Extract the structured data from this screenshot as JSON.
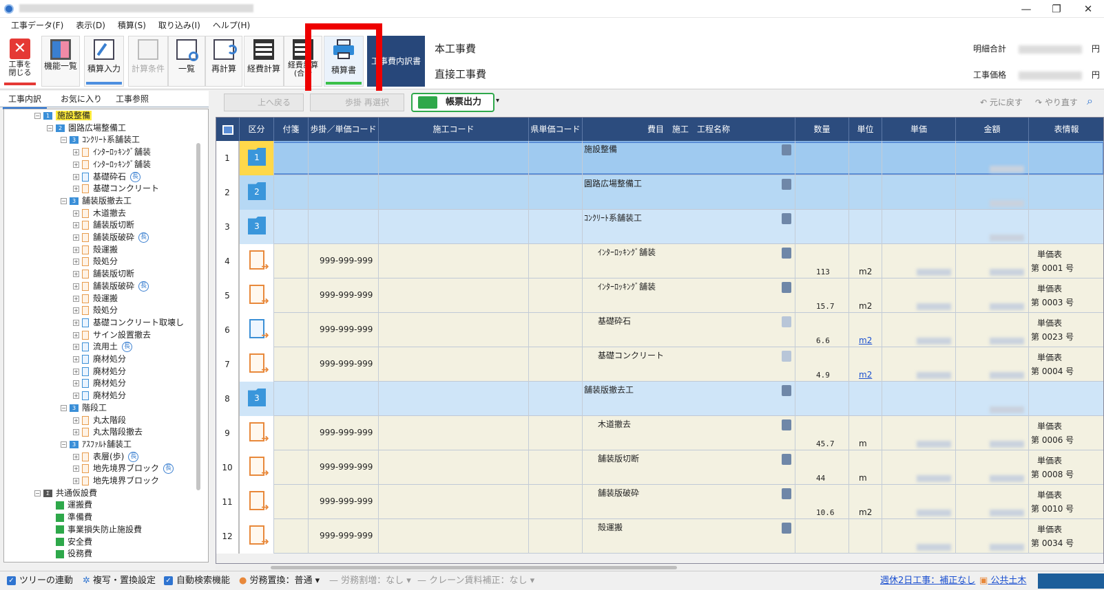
{
  "window": {
    "minimize": "—",
    "maximize": "❐",
    "close": "✕"
  },
  "menu": [
    "工事データ(F)",
    "表示(D)",
    "積算(S)",
    "取り込み(I)",
    "ヘルプ(H)"
  ],
  "ribbon": {
    "close": "工事を\n閉じる",
    "func_list": "機能一覧",
    "sekisan_input": "積算入力",
    "sekisan_cond": "計算条件",
    "ichiran": "一覧",
    "recalc": "再計算",
    "keihi_calc": "経費計算",
    "keihi_total": "経費計算\n(合計",
    "sekisansho": "積算書",
    "breakdown_box": "工事費内訳書",
    "title_main": "本工事費",
    "title_sub": "直接工事費",
    "summary_label_1": "明細合計",
    "summary_label_2": "工事価格",
    "yen": "円"
  },
  "left_tabs": [
    "工事内訳",
    "お気に入り",
    "工事参照"
  ],
  "tree": [
    {
      "label": "施設整備",
      "level": 1,
      "kind": "folder",
      "num": "1",
      "highlight": true
    },
    {
      "label": "園路広場整備工",
      "level": 2,
      "kind": "folder",
      "num": "2"
    },
    {
      "label": "ｺﾝｸﾘｰﾄ系舗装工",
      "level": 3,
      "kind": "folder",
      "num": "3"
    },
    {
      "label": "ｲﾝﾀｰﾛｯｷﾝｸﾞ舗装",
      "level": 4,
      "kind": "doc"
    },
    {
      "label": "ｲﾝﾀｰﾛｯｷﾝｸﾞ舗装",
      "level": 4,
      "kind": "doc"
    },
    {
      "label": "基礎砕石",
      "level": 4,
      "kind": "docblue",
      "cho": true
    },
    {
      "label": "基礎コンクリート",
      "level": 4,
      "kind": "doc"
    },
    {
      "label": "舗装版撤去工",
      "level": 3,
      "kind": "folder",
      "num": "3"
    },
    {
      "label": "木道撤去",
      "level": 4,
      "kind": "doc"
    },
    {
      "label": "舗装版切断",
      "level": 4,
      "kind": "doc"
    },
    {
      "label": "舗装版破砕",
      "level": 4,
      "kind": "doc",
      "cho": true
    },
    {
      "label": "殻運搬",
      "level": 4,
      "kind": "doc"
    },
    {
      "label": "殻処分",
      "level": 4,
      "kind": "doc"
    },
    {
      "label": "舗装版切断",
      "level": 4,
      "kind": "doc"
    },
    {
      "label": "舗装版破砕",
      "level": 4,
      "kind": "doc",
      "cho": true
    },
    {
      "label": "殻運搬",
      "level": 4,
      "kind": "doc"
    },
    {
      "label": "殻処分",
      "level": 4,
      "kind": "doc"
    },
    {
      "label": "基礎コンクリート取壊し",
      "level": 4,
      "kind": "docblue"
    },
    {
      "label": "サイン設置撤去",
      "level": 4,
      "kind": "doc"
    },
    {
      "label": "流用土",
      "level": 4,
      "kind": "docblue",
      "cho": true
    },
    {
      "label": "廃材処分",
      "level": 4,
      "kind": "docblue"
    },
    {
      "label": "廃材処分",
      "level": 4,
      "kind": "docblue"
    },
    {
      "label": "廃材処分",
      "level": 4,
      "kind": "docblue"
    },
    {
      "label": "廃材処分",
      "level": 4,
      "kind": "docblue"
    },
    {
      "label": "階段工",
      "level": 3,
      "kind": "folder",
      "num": "3"
    },
    {
      "label": "丸太階段",
      "level": 4,
      "kind": "doc"
    },
    {
      "label": "丸太階段撤去",
      "level": 4,
      "kind": "doc"
    },
    {
      "label": "ｱｽﾌｧﾙﾄ舗装工",
      "level": 3,
      "kind": "folder",
      "num": "3"
    },
    {
      "label": "表層(歩)",
      "level": 4,
      "kind": "doc",
      "cho": true
    },
    {
      "label": "地先境界ブロック",
      "level": 4,
      "kind": "doc",
      "cho": true
    },
    {
      "label": "地先境界ブロック",
      "level": 4,
      "kind": "doc"
    },
    {
      "label": "共通仮設費",
      "level": 1,
      "kind": "sigma"
    },
    {
      "label": "運搬費",
      "level": 2,
      "kind": "green"
    },
    {
      "label": "準備費",
      "level": 2,
      "kind": "green"
    },
    {
      "label": "事業損失防止施設費",
      "level": 2,
      "kind": "green"
    },
    {
      "label": "安全費",
      "level": 2,
      "kind": "green"
    },
    {
      "label": "役務費",
      "level": 2,
      "kind": "green"
    }
  ],
  "toolbar2": {
    "back": "上へ戻る",
    "multi_select": "歩掛 再選択",
    "chohyo": "帳票出力",
    "undo": "元に戻す",
    "redo": "やり直す"
  },
  "grid_headers": [
    "区分",
    "付箋",
    "歩掛／単価コード",
    "施工コード",
    "県単価コード",
    "費目　施工　工程名称",
    "数量",
    "単位",
    "単価",
    "金額",
    "表情報"
  ],
  "grid_rows": [
    {
      "no": "1",
      "kind": "folder",
      "num": "1",
      "code": "",
      "name": "施設整備",
      "qty": "",
      "unit": "",
      "info1": "",
      "info2": "",
      "bg": "#9fcaf0",
      "selected": true
    },
    {
      "no": "2",
      "kind": "folder",
      "num": "2",
      "code": "",
      "name": "園路広場整備工",
      "qty": "",
      "unit": "",
      "info1": "",
      "info2": "",
      "bg": "#b6d8f4"
    },
    {
      "no": "3",
      "kind": "folder",
      "num": "3",
      "code": "",
      "name": "ｺﾝｸﾘｰﾄ系舗装工",
      "qty": "",
      "unit": "",
      "info1": "",
      "info2": "",
      "bg": "#cfe5f8"
    },
    {
      "no": "4",
      "kind": "doc",
      "code": "999-999-999",
      "name": "ｲﾝﾀｰﾛｯｷﾝｸﾞ舗装",
      "qty": "113",
      "unit": "m2",
      "info1": "単価表",
      "info2": "第 0001 号",
      "bg": "#f3f1e1"
    },
    {
      "no": "5",
      "kind": "doc",
      "code": "999-999-999",
      "name": "ｲﾝﾀｰﾛｯｷﾝｸﾞ舗装",
      "qty": "15.7",
      "unit": "m2",
      "info1": "単価表",
      "info2": "第 0003 号",
      "bg": "#f3f1e1"
    },
    {
      "no": "6",
      "kind": "docblue",
      "code": "999-999-999",
      "name": "基礎砕石",
      "qty": "6.6",
      "unit": "m2",
      "unitlink": true,
      "info1": "単価表",
      "info2": "第 0023 号",
      "bg": "#f3f1e1",
      "lockdim": true
    },
    {
      "no": "7",
      "kind": "doc",
      "code": "999-999-999",
      "name": "基礎コンクリート",
      "qty": "4.9",
      "unit": "m2",
      "unitlink": true,
      "info1": "単価表",
      "info2": "第 0004 号",
      "bg": "#f3f1e1",
      "lockdim": true
    },
    {
      "no": "8",
      "kind": "folder",
      "num": "3",
      "code": "",
      "name": "舗装版撤去工",
      "qty": "",
      "unit": "",
      "info1": "",
      "info2": "",
      "bg": "#cfe5f8"
    },
    {
      "no": "9",
      "kind": "doc",
      "code": "999-999-999",
      "name": "木道撤去",
      "qty": "45.7",
      "unit": "m",
      "info1": "単価表",
      "info2": "第 0006 号",
      "bg": "#f3f1e1"
    },
    {
      "no": "10",
      "kind": "doc",
      "code": "999-999-999",
      "name": "舗装版切断",
      "qty": "44",
      "unit": "m",
      "info1": "単価表",
      "info2": "第 0008 号",
      "bg": "#f3f1e1"
    },
    {
      "no": "11",
      "kind": "doc",
      "code": "999-999-999",
      "name": "舗装版破砕",
      "qty": "10.6",
      "unit": "m2",
      "info1": "単価表",
      "info2": "第 0010 号",
      "bg": "#f3f1e1"
    },
    {
      "no": "12",
      "kind": "doc",
      "code": "999-999-999",
      "name": "殻運搬",
      "qty": "",
      "unit": "",
      "info1": "単価表",
      "info2": "第 0034 号",
      "bg": "#f3f1e1"
    }
  ],
  "status": {
    "tree_link": "ツリーの連動",
    "copy_replace": "複写・置換設定",
    "auto_search": "自動検索機能",
    "labor": "労務置換：普通",
    "labor_rate": "労務割増：なし",
    "crane": "クレーン賃料補正：なし",
    "week2": "週休2日工事：補正なし",
    "public": "公共土木"
  }
}
